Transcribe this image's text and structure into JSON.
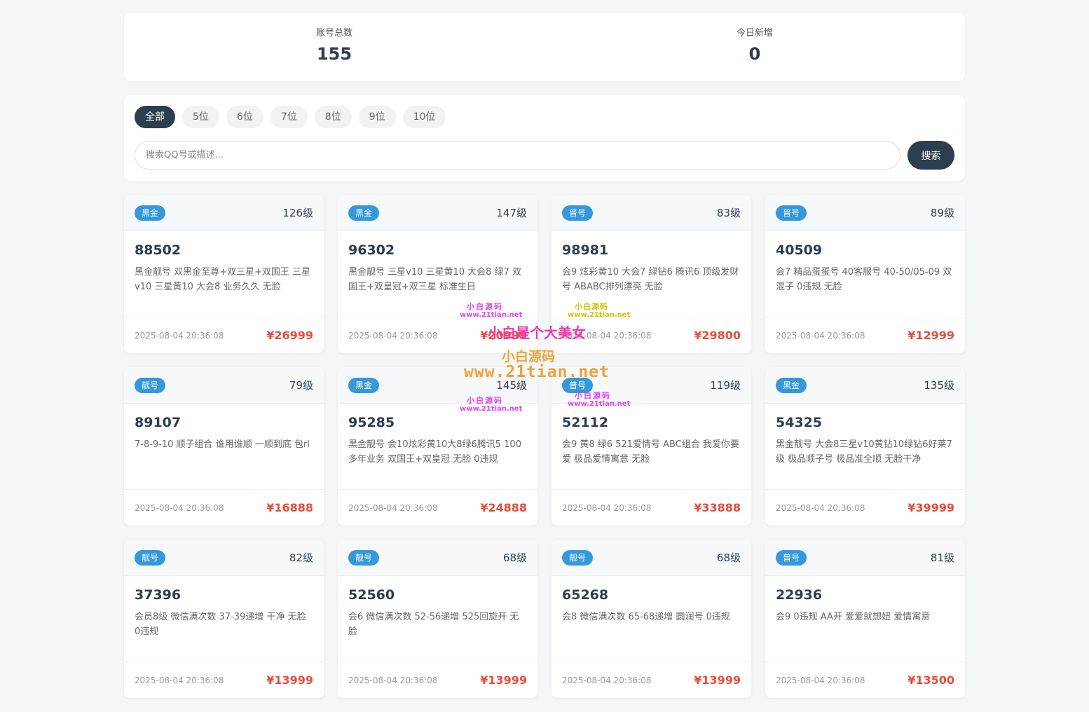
{
  "stats": {
    "total_label": "账号总数",
    "total_value": "155",
    "today_label": "今日新增",
    "today_value": "0"
  },
  "tabs": [
    "全部",
    "5位",
    "6位",
    "7位",
    "8位",
    "9位",
    "10位"
  ],
  "active_tab": "全部",
  "search": {
    "placeholder": "搜索QQ号或描述...",
    "value": "",
    "button_label": "搜索"
  },
  "colors": {
    "accent": "#2c3e50",
    "badge": "#3498db",
    "price": "#e74c3c"
  },
  "cards": [
    {
      "badge": "黑金",
      "level": "126级",
      "qq": "88502",
      "desc": "黑金靓号 双黑金至尊+双三星+双国王 三星v10 三星黄10 大会8 业务久久 无脸",
      "time": "2025-08-04 20:36:08",
      "price": "¥26999"
    },
    {
      "badge": "黑金",
      "level": "147级",
      "qq": "96302",
      "desc": "黑金靓号 三星v10 三星黄10 大会8 绿7 双国王+双皇冠+双三星 标准生日",
      "time": "2025-08-04 20:36:08",
      "price": "¥20999"
    },
    {
      "badge": "普号",
      "level": "83级",
      "qq": "98981",
      "desc": "会9 炫彩黄10 大会7 绿钻6 腾讯6 顶级发财号 ABABC排列漂亮 无脸",
      "time": "2025-08-04 20:36:08",
      "price": "¥29800"
    },
    {
      "badge": "普号",
      "level": "89级",
      "qq": "40509",
      "desc": "会7 精品蛋蛋号 40客服号 40-50/05-09 双混子 0违规 无脸",
      "time": "2025-08-04 20:36:08",
      "price": "¥12999"
    },
    {
      "badge": "靓号",
      "level": "79级",
      "qq": "89107",
      "desc": "7-8-9-10 顺子组合 谁用谁顺 一顺到底 包rl",
      "time": "2025-08-04 20:36:08",
      "price": "¥16888"
    },
    {
      "badge": "黑金",
      "level": "145级",
      "qq": "95285",
      "desc": "黑金靓号 会10炫彩黄10大8绿6腾讯5 100多年业务 双国王+双皇冠 无脸 0违规",
      "time": "2025-08-04 20:36:08",
      "price": "¥24888"
    },
    {
      "badge": "普号",
      "level": "119级",
      "qq": "52112",
      "desc": "会9 黄8 绿6 521爱情号 ABC组合 我爱你要爱 极品爱情寓意 无脸",
      "time": "2025-08-04 20:36:08",
      "price": "¥33888"
    },
    {
      "badge": "黑金",
      "level": "135级",
      "qq": "54325",
      "desc": "黑金靓号 大会8三星v10黄钻10绿钻6好莱7级 极品顺子号 极品准全顺 无脸干净",
      "time": "2025-08-04 20:36:08",
      "price": "¥39999"
    },
    {
      "badge": "靓号",
      "level": "82级",
      "qq": "37396",
      "desc": "会员8级 微信满次数 37-39递增 干净 无脸 0违规",
      "time": "2025-08-04 20:36:08",
      "price": "¥13999"
    },
    {
      "badge": "靓号",
      "level": "68级",
      "qq": "52560",
      "desc": "会6 微信满次数 52-56递增 525回旋开 无脸",
      "time": "2025-08-04 20:36:08",
      "price": "¥13999"
    },
    {
      "badge": "靓号",
      "level": "68级",
      "qq": "65268",
      "desc": "会8 微信满次数 65-68递增 圆润号 0违规",
      "time": "2025-08-04 20:36:08",
      "price": "¥13999"
    },
    {
      "badge": "普号",
      "level": "81级",
      "qq": "22936",
      "desc": "会9 0违规 AA开 爱爱就想妞 爱情寓意",
      "time": "2025-08-04 20:36:08",
      "price": "¥13500"
    }
  ],
  "watermark": {
    "small_text": "小白源码",
    "small_url": "www.21tian.net",
    "big_text": "小白是个大美女",
    "orange_text": "小白源码",
    "orange_url": "www.21tian.net"
  }
}
